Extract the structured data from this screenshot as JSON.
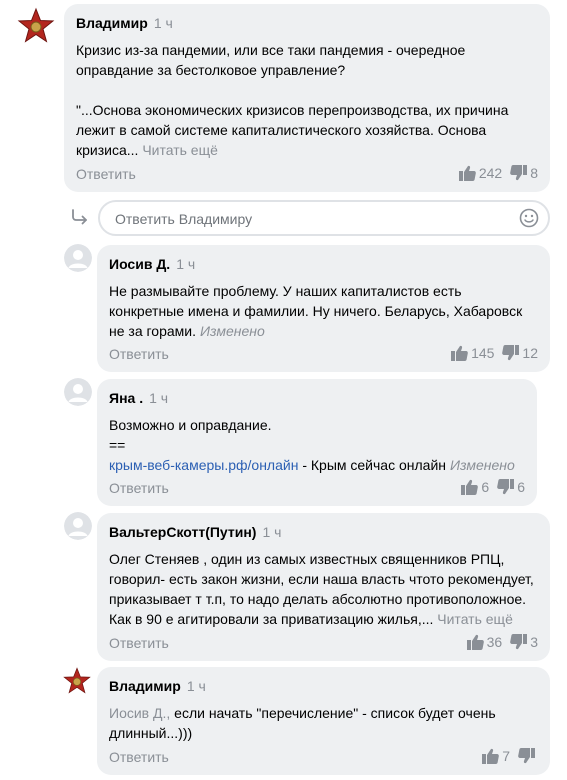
{
  "comments": [
    {
      "author": "Владимир",
      "time": "1 ч",
      "paragraphs": [
        "Кризис из-за пандемии, или все таки пандемия - очередное оправдание за бестолковое управление?",
        "\"...Основа экономических кризисов перепроизводства, их причина лежит в самой системе капиталистического хозяйства. Основа кризиса..."
      ],
      "more": "Читать ещё",
      "reply": "Ответить",
      "likes": "242",
      "dislikes": "8"
    },
    {
      "author": "Иосив Д.",
      "time": "1 ч",
      "text": "Не размывайте проблему. У наших капиталистов есть конкретные имена и фамилии. Ну ничего. Беларусь, Хабаровск не за горами.",
      "edited": "Изменено",
      "reply": "Ответить",
      "likes": "145",
      "dislikes": "12"
    },
    {
      "author": "Яна .",
      "time": "1 ч",
      "line1": "Возможно и оправдание.",
      "line2": "==",
      "link": "крым-веб-камеры.рф/онлайн",
      "link_tail": " - Крым сейчас онлайн",
      "edited": "Изменено",
      "reply": "Ответить",
      "likes": "6",
      "dislikes": "6"
    },
    {
      "author": "ВальтерСкотт(Путин)",
      "time": "1 ч",
      "text": "Олег Стеняев , один из самых известных священников РПЦ, говорил- есть закон жизни, если наша власть чтото рекомендует, приказывает т т.п, то надо делать абсолютно противоположное. Как в 90 е агитировали за приватизацию жилья,...",
      "more": "Читать ещё",
      "reply": "Ответить",
      "likes": "36",
      "dislikes": "3"
    },
    {
      "author": "Владимир",
      "time": "1 ч",
      "mention": "Иосив Д.,",
      "text": " если начать \"перечисление\" - список будет очень длинный...)))",
      "reply": "Ответить",
      "likes": "7",
      "dislikes": ""
    }
  ],
  "reply_box": {
    "placeholder": "Ответить Владимиру"
  },
  "colors": {
    "bubble": "#eef0f2",
    "muted": "#8a8f96",
    "link": "#2b5fb3",
    "star": "#b3261e"
  }
}
